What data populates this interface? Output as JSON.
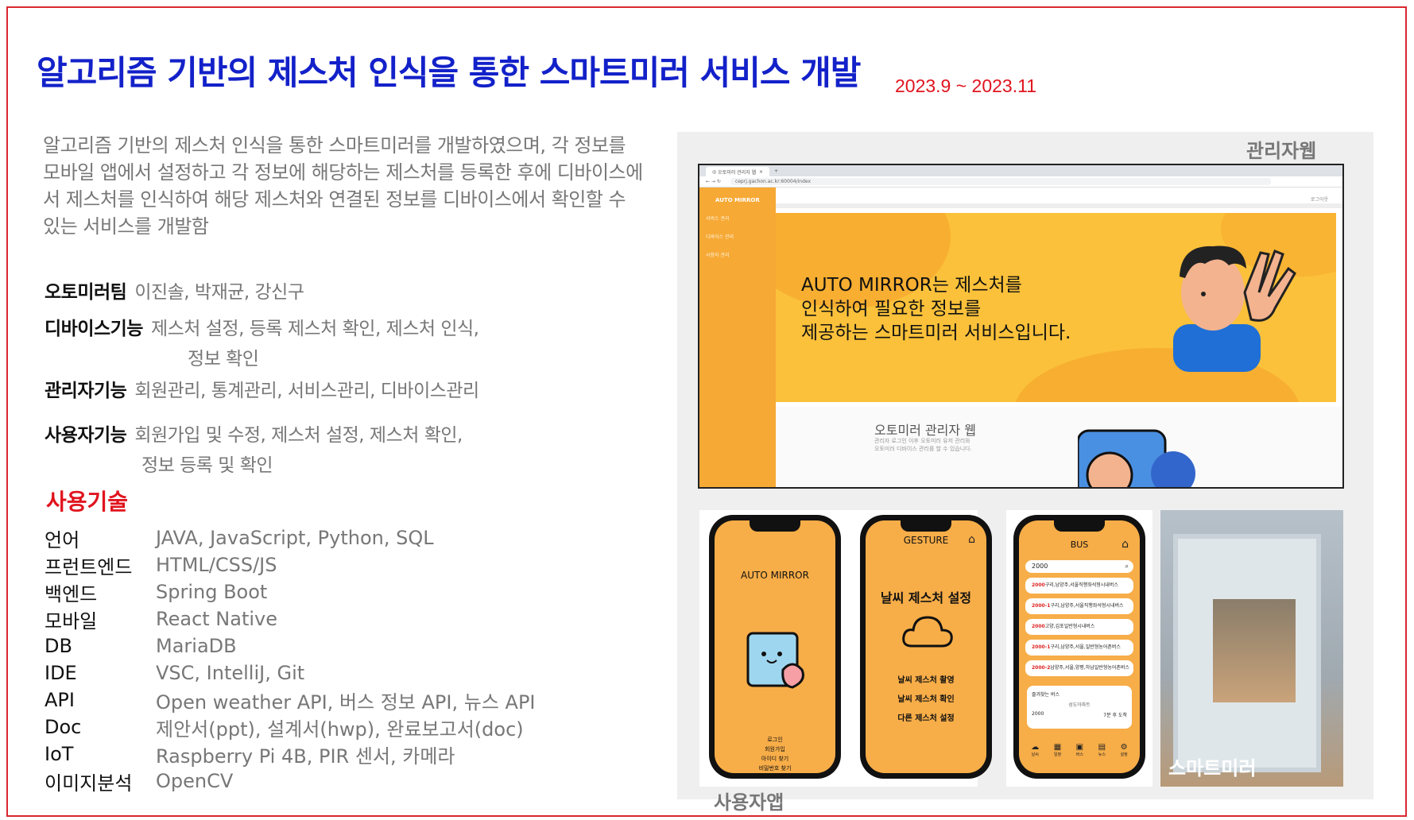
{
  "title": "알고리즘 기반의 제스처 인식을 통한 스마트미러 서비스 개발",
  "date": "2023.9 ~ 2023.11",
  "description": "알고리즘 기반의 제스처 인식을 통한 스마트미러를 개발하였으며, 각 정보를 모바일 앱에서 설정하고 각 정보에 해당하는 제스처를 등록한 후에 디바이스에서 제스처를 인식하여 해당 제스처와 연결된 정보를 디바이스에서 확인할 수 있는 서비스를 개발함",
  "features": {
    "team_label": "오토미러팀",
    "team_value": "이진솔, 박재균, 강신구",
    "device_label": "디바이스기능",
    "device_value": "제스처 설정, 등록 제스처 확인, 제스처 인식,",
    "device_value2": "정보 확인",
    "admin_label": "관리자기능",
    "admin_value": "회원관리, 통계관리, 서비스관리, 디바이스관리",
    "user_label": "사용자기능",
    "user_value": "회원가입 및 수정, 제스처 설정, 제스처 확인,",
    "user_value2": "정보 등록 및 확인"
  },
  "tech_title": "사용기술",
  "tech": [
    {
      "k": "언어",
      "v": "JAVA, JavaScript, Python, SQL"
    },
    {
      "k": "프런트엔드",
      "v": "HTML/CSS/JS"
    },
    {
      "k": "백엔드",
      "v": "Spring Boot"
    },
    {
      "k": "모바일",
      "v": "React Native"
    },
    {
      "k": "DB",
      "v": "MariaDB"
    },
    {
      "k": "IDE",
      "v": "VSC, IntelliJ, Git"
    },
    {
      "k": "API",
      "v": "Open weather API, 버스 정보 API, 뉴스 API"
    },
    {
      "k": "Doc",
      "v": "제안서(ppt), 설계서(hwp), 완료보고서(doc)"
    },
    {
      "k": "IoT",
      "v": "Raspberry Pi 4B, PIR 센서, 카메라"
    },
    {
      "k": "이미지분석",
      "v": "OpenCV"
    }
  ],
  "admin_web": {
    "label": "관리자웹",
    "tab": "오토미러 관리자 웹",
    "url": "ceprj.gachon.ac.kr:60004/index",
    "brand": "AUTO MIRROR",
    "menu": [
      "서비스 관리",
      "디바이스 관리",
      "사용자 관리"
    ],
    "logout": "로그아웃",
    "hero_line1": "AUTO MIRROR는 제스처를",
    "hero_line2": "인식하여  필요한 정보를",
    "hero_line3": "제공하는 스마트미러 서비스입니다.",
    "section_title": "오토미러 관리자 웹",
    "section_sub1": "관리자 로그인 이후 오토미러 유저 관리와",
    "section_sub2": "오토미러 디바이스 관리를 할 수 있습니다."
  },
  "phone1": {
    "title": "AUTO MIRROR",
    "links": [
      "로그인",
      "회원가입",
      "아이디 찾기",
      "비밀번호 찾기"
    ]
  },
  "phone2": {
    "title": "GESTURE",
    "heading": "날씨 제스처 설정",
    "options": [
      "날씨 제스처 촬영",
      "날씨 제스처 확인",
      "다른 제스처 설정"
    ]
  },
  "phone3": {
    "title": "BUS",
    "search": "2000",
    "rows": [
      {
        "num": "2000",
        "route": "구리,남양주,서울직행좌석형시내버스"
      },
      {
        "num": "2000-1",
        "route": "구리,남양주,서울직행좌석형시내버스"
      },
      {
        "num": "2000",
        "route": "고양,김포일반형시내버스"
      },
      {
        "num": "2000-1",
        "route": "구리,남양주,서울,일반형농어촌버스"
      },
      {
        "num": "2000-2",
        "route": "남양주,서울,양평,하남일반형농어촌버스"
      }
    ],
    "fav_title": "즐겨찾는 버스",
    "fav_stop": "성도아파트",
    "fav_num": "2000",
    "fav_eta": "7분 후 도착",
    "nav": [
      "날씨",
      "일정",
      "버스",
      "뉴스",
      "설정"
    ]
  },
  "user_app_label": "사용자앱",
  "mirror_label": "스마트미러",
  "colors": {
    "title": "#1321c9",
    "accent_red": "#e0141e",
    "app_orange": "#f7ad48",
    "hero_yellow": "#fbc13a"
  }
}
